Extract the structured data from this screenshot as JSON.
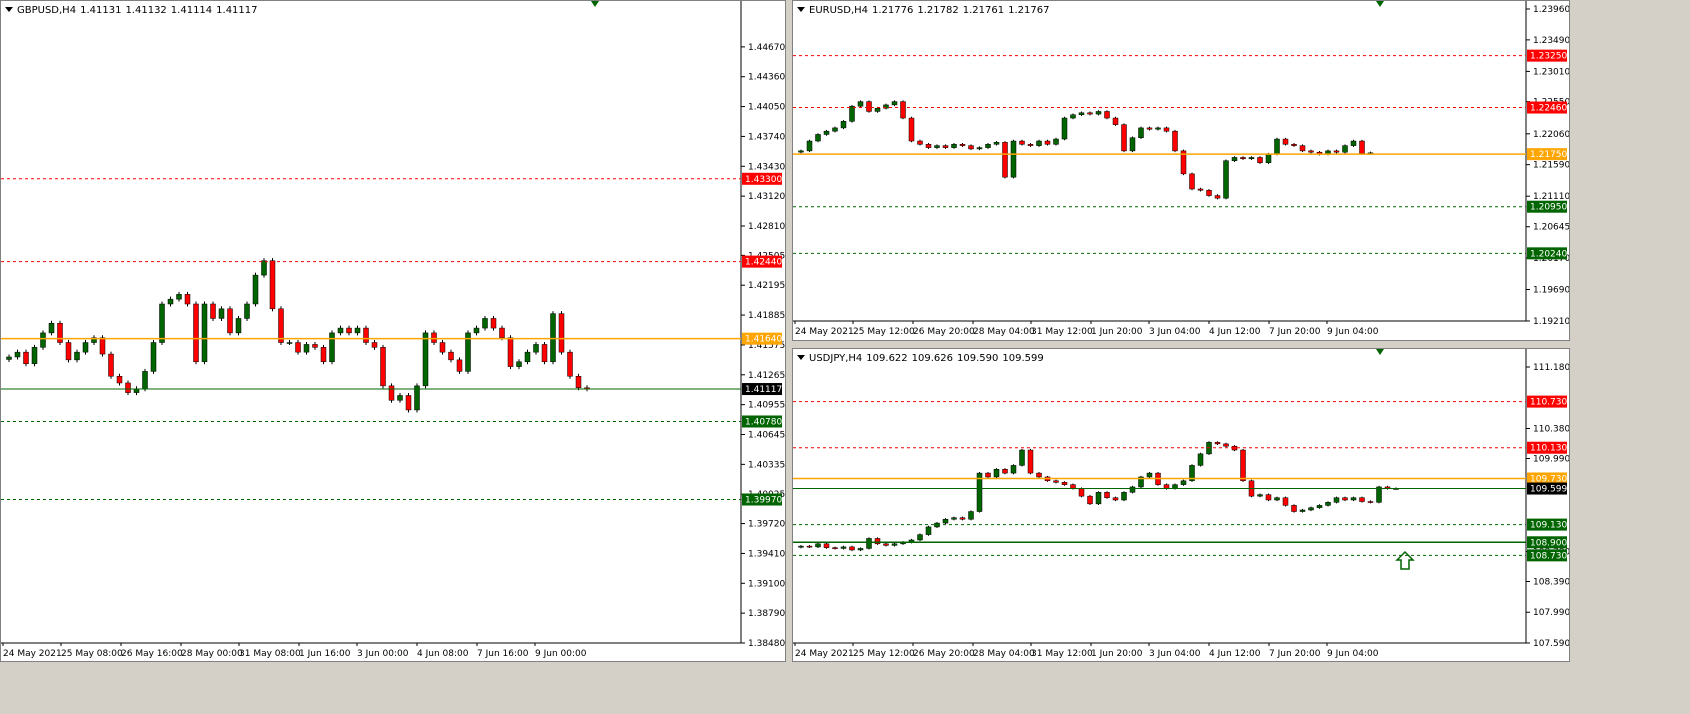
{
  "chart_data": [
    {
      "type": "candlestick",
      "symbol": "GBPUSD,H4",
      "ohlc": [
        "1.41131",
        "1.41132",
        "1.41114",
        "1.41117"
      ],
      "ylim": [
        1.3848,
        1.4498
      ],
      "y_ticks": [
        "1.44670",
        "1.44360",
        "1.44050",
        "1.43740",
        "1.43430",
        "1.43120",
        "1.42810",
        "1.42505",
        "1.42195",
        "1.41885",
        "1.41575",
        "1.41265",
        "1.40955",
        "1.40645",
        "1.40335",
        "1.40025",
        "1.39720",
        "1.39410",
        "1.39100",
        "1.38790",
        "1.38480"
      ],
      "x_labels": [
        "24 May 2021",
        "25 May 08:00",
        "26 May 16:00",
        "28 May 00:00",
        "31 May 08:00",
        "1 Jun 16:00",
        "3 Jun 00:00",
        "4 Jun 08:00",
        "7 Jun 16:00",
        "9 Jun 00:00"
      ],
      "levels": [
        {
          "label": "1.43300",
          "value": 1.433,
          "color": "#ff0000",
          "style": "dashed"
        },
        {
          "label": "1.42440",
          "value": 1.4244,
          "color": "#ff0000",
          "style": "dashed"
        },
        {
          "label": "1.41640",
          "value": 1.4164,
          "color": "#ffa500",
          "style": "solid"
        },
        {
          "label": "1.41117",
          "value": 1.41117,
          "color": "#000000",
          "style": "current"
        },
        {
          "label": "1.40780",
          "value": 1.4078,
          "color": "#006400",
          "style": "dashed"
        },
        {
          "label": "1.39970",
          "value": 1.3997,
          "color": "#006400",
          "style": "dashed"
        }
      ],
      "closes": [
        1.4145,
        1.415,
        1.4138,
        1.4155,
        1.417,
        1.418,
        1.416,
        1.4142,
        1.415,
        1.416,
        1.4165,
        1.4148,
        1.4125,
        1.4118,
        1.4108,
        1.4112,
        1.413,
        1.416,
        1.42,
        1.4205,
        1.421,
        1.42,
        1.414,
        1.42,
        1.4185,
        1.4195,
        1.417,
        1.4185,
        1.42,
        1.423,
        1.4245,
        1.4195,
        1.416,
        1.416,
        1.415,
        1.4158,
        1.4155,
        1.414,
        1.417,
        1.4175,
        1.417,
        1.4175,
        1.416,
        1.4155,
        1.4115,
        1.41,
        1.4105,
        1.409,
        1.4115,
        1.417,
        1.416,
        1.415,
        1.4142,
        1.413,
        1.417,
        1.4175,
        1.4185,
        1.4175,
        1.4165,
        1.4135,
        1.414,
        1.415,
        1.4158,
        1.414,
        1.419,
        1.415,
        1.4125,
        1.4113,
        1.4112
      ]
    },
    {
      "type": "candlestick",
      "symbol": "EURUSD,H4",
      "ohlc": [
        "1.21776",
        "1.21782",
        "1.21761",
        "1.21767"
      ],
      "ylim": [
        1.1921,
        1.2396
      ],
      "y_ticks": [
        "1.23960",
        "1.23490",
        "1.23010",
        "1.22550",
        "1.22060",
        "1.21590",
        "1.21110",
        "1.20645",
        "1.20170",
        "1.19690",
        "1.19210"
      ],
      "x_labels": [
        "24 May 2021",
        "25 May 12:00",
        "26 May 20:00",
        "28 May 04:00",
        "31 May 12:00",
        "1 Jun 20:00",
        "3 Jun 04:00",
        "4 Jun 12:00",
        "7 Jun 20:00",
        "9 Jun 04:00"
      ],
      "levels": [
        {
          "label": "1.23250",
          "value": 1.2325,
          "color": "#ff0000",
          "style": "dashed"
        },
        {
          "label": "1.22460",
          "value": 1.2246,
          "color": "#ff0000",
          "style": "dashed"
        },
        {
          "label": "1.21750",
          "value": 1.2175,
          "color": "#ffa500",
          "style": "solid"
        },
        {
          "label": "1.20950",
          "value": 1.2095,
          "color": "#006400",
          "style": "dashed"
        },
        {
          "label": "1.20240",
          "value": 1.2024,
          "color": "#006400",
          "style": "dashed"
        }
      ],
      "closes": [
        1.218,
        1.2195,
        1.2205,
        1.221,
        1.2215,
        1.2225,
        1.2248,
        1.2255,
        1.224,
        1.2245,
        1.225,
        1.2255,
        1.223,
        1.2195,
        1.219,
        1.2185,
        1.2188,
        1.2185,
        1.219,
        1.2188,
        1.2183,
        1.2185,
        1.219,
        1.2193,
        1.214,
        1.2195,
        1.219,
        1.2188,
        1.2195,
        1.219,
        1.2198,
        1.223,
        1.2235,
        1.2238,
        1.2236,
        1.224,
        1.223,
        1.222,
        1.218,
        1.22,
        1.2215,
        1.2213,
        1.2215,
        1.221,
        1.218,
        1.2145,
        1.2122,
        1.212,
        1.2112,
        1.2108,
        1.2165,
        1.217,
        1.2168,
        1.217,
        1.2162,
        1.2175,
        1.2198,
        1.219,
        1.2188,
        1.218,
        1.2178,
        1.2175,
        1.218,
        1.2178,
        1.2188,
        1.2195,
        1.2176,
        1.2177
      ]
    },
    {
      "type": "candlestick",
      "symbol": "USDJPY,H4",
      "ohlc": [
        "109.622",
        "109.626",
        "109.590",
        "109.599"
      ],
      "ylim": [
        107.59,
        111.18
      ],
      "y_ticks": [
        "111.180",
        "110.380",
        "109.990",
        "108.780",
        "108.390",
        "107.990",
        "107.590"
      ],
      "x_labels": [
        "24 May 2021",
        "25 May 12:00",
        "26 May 20:00",
        "28 May 04:00",
        "31 May 12:00",
        "1 Jun 20:00",
        "3 Jun 04:00",
        "4 Jun 12:00",
        "7 Jun 20:00",
        "9 Jun 04:00"
      ],
      "levels": [
        {
          "label": "110.730",
          "value": 110.73,
          "color": "#ff0000",
          "style": "dashed"
        },
        {
          "label": "110.130",
          "value": 110.13,
          "color": "#ff0000",
          "style": "dashed"
        },
        {
          "label": "109.730",
          "value": 109.73,
          "color": "#ffa500",
          "style": "solid"
        },
        {
          "label": "109.599",
          "value": 109.599,
          "color": "#000000",
          "style": "current"
        },
        {
          "label": "109.130",
          "value": 109.13,
          "color": "#006400",
          "style": "dashed"
        },
        {
          "label": "108.900",
          "value": 108.9,
          "color": "#006400",
          "style": "solid"
        },
        {
          "label": "108.730",
          "value": 108.73,
          "color": "#006400",
          "style": "dashed"
        }
      ],
      "closes": [
        108.85,
        108.84,
        108.88,
        108.83,
        108.82,
        108.84,
        108.8,
        108.82,
        108.95,
        108.88,
        108.86,
        108.88,
        108.9,
        108.93,
        109.0,
        109.1,
        109.15,
        109.2,
        109.22,
        109.2,
        109.3,
        109.8,
        109.75,
        109.85,
        109.8,
        109.9,
        110.1,
        109.8,
        109.75,
        109.7,
        109.68,
        109.65,
        109.6,
        109.5,
        109.4,
        109.55,
        109.48,
        109.45,
        109.55,
        109.62,
        109.75,
        109.8,
        109.65,
        109.6,
        109.65,
        109.7,
        109.9,
        110.05,
        110.2,
        110.18,
        110.15,
        110.1,
        109.7,
        109.5,
        109.52,
        109.45,
        109.48,
        109.38,
        109.3,
        109.32,
        109.35,
        109.38,
        109.42,
        109.48,
        109.45,
        109.48,
        109.43,
        109.42,
        109.62,
        109.6,
        109.6
      ]
    }
  ]
}
